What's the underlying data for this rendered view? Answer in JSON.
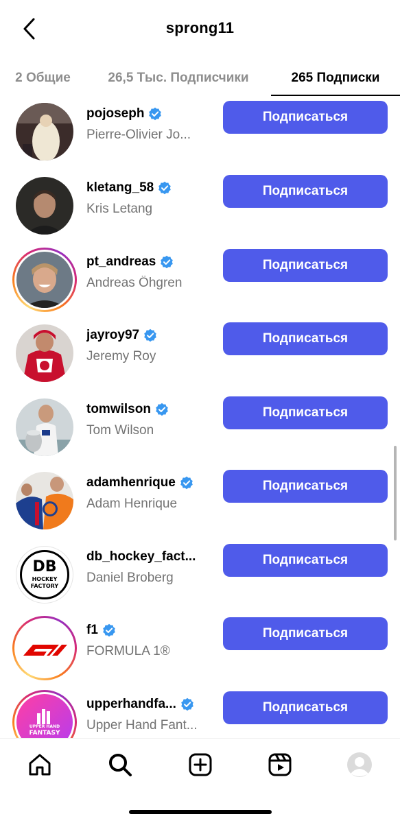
{
  "header": {
    "title": "sprong11"
  },
  "tabs": [
    {
      "label": "2 Общие"
    },
    {
      "label": "26,5 Тыс. Подписчики"
    },
    {
      "label": "265 Подписки"
    }
  ],
  "accounts": [
    {
      "username": "pojoseph",
      "fullname": "Pierre-Olivier Jo...",
      "button": "Подписаться"
    },
    {
      "username": "kletang_58",
      "fullname": "Kris Letang",
      "button": "Подписаться"
    },
    {
      "username": "pt_andreas",
      "fullname": "Andreas Öhgren",
      "button": "Подписаться"
    },
    {
      "username": "jayroy97",
      "fullname": "Jeremy Roy",
      "button": "Подписаться"
    },
    {
      "username": "tomwilson",
      "fullname": "Tom Wilson",
      "button": "Подписаться"
    },
    {
      "username": "adamhenrique",
      "fullname": "Adam Henrique",
      "button": "Подписаться"
    },
    {
      "username": "db_hockey_fact...",
      "fullname": "Daniel Broberg",
      "button": "Подписаться"
    },
    {
      "username": "f1",
      "fullname": "FORMULA 1®",
      "button": "Подписаться"
    },
    {
      "username": "upperhandfa...",
      "fullname": "Upper Hand Fant...",
      "button": "Подписаться"
    }
  ],
  "logos": {
    "db_line1": "DB",
    "db_line2": "HOCKEY",
    "db_line3": "FACTORY",
    "upper_line1": "UPPER HAND",
    "upper_line2": "FANTASY"
  },
  "nav": [
    "home-icon",
    "search-icon",
    "create-icon",
    "reels-icon",
    "profile-icon"
  ],
  "colors": {
    "follow_button": "#4f5bea",
    "verified": "#3897f0",
    "secondary_text": "#737373"
  }
}
